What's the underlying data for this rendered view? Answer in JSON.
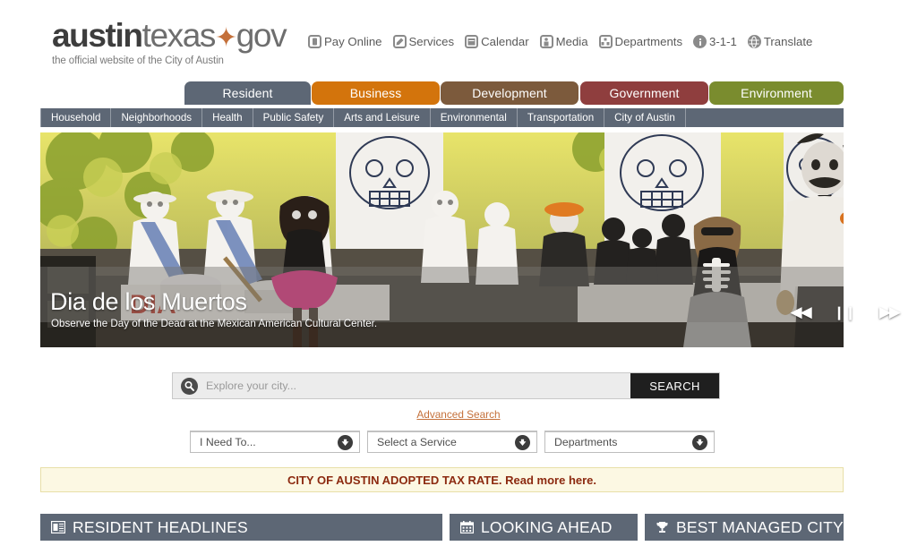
{
  "header": {
    "logo": {
      "bold_part": "austin",
      "light_part": "texas",
      "star": "★",
      "gov_part": "gov",
      "tagline": "the official website of the City of Austin"
    },
    "top_links": [
      {
        "label": "Pay Online",
        "icon": "pay-online-icon"
      },
      {
        "label": "Services",
        "icon": "services-icon"
      },
      {
        "label": "Calendar",
        "icon": "calendar-icon"
      },
      {
        "label": "Media",
        "icon": "media-icon"
      },
      {
        "label": "Departments",
        "icon": "departments-icon"
      },
      {
        "label": "3-1-1",
        "icon": "info-icon"
      },
      {
        "label": "Translate",
        "icon": "globe-icon"
      }
    ]
  },
  "main_tabs": [
    {
      "label": "Resident",
      "color": "#5d6775",
      "active": true
    },
    {
      "label": "Business",
      "color": "#d3740c",
      "active": false
    },
    {
      "label": "Development",
      "color": "#7c5a3c",
      "active": false
    },
    {
      "label": "Government",
      "color": "#8f3e3e",
      "active": false
    },
    {
      "label": "Environment",
      "color": "#7a8c2e",
      "active": false
    }
  ],
  "sub_nav": [
    {
      "label": "Household"
    },
    {
      "label": "Neighborhoods"
    },
    {
      "label": "Health"
    },
    {
      "label": "Public Safety"
    },
    {
      "label": "Arts and Leisure"
    },
    {
      "label": "Environmental"
    },
    {
      "label": "Transportation"
    },
    {
      "label": "City of Austin"
    }
  ],
  "hero": {
    "title": "Dia de los Muertos",
    "subtitle": "Observe the Day of the Dead at the Mexican American Cultural Center.",
    "controls": {
      "previous": "◀◀",
      "pause": "❙❙",
      "next": "▶▶"
    }
  },
  "search": {
    "placeholder": "Explore your city...",
    "button_label": "SEARCH",
    "advanced_label": "Advanced Search",
    "icon": "search-icon"
  },
  "dropdowns": [
    {
      "label": "I Need To..."
    },
    {
      "label": "Select a Service"
    },
    {
      "label": "Departments"
    }
  ],
  "alert": {
    "strong_text": "CITY OF AUSTIN ADOPTED TAX RATE.",
    "link_text": "Read more here.",
    "background": "#fcf8e3",
    "text_color": "#8c2a10"
  },
  "panels": [
    {
      "title": "RESIDENT HEADLINES",
      "icon": "newspaper-icon"
    },
    {
      "title": "LOOKING AHEAD",
      "icon": "calendar-icon"
    },
    {
      "title": "BEST MANAGED CITY",
      "icon": "trophy-icon"
    }
  ]
}
